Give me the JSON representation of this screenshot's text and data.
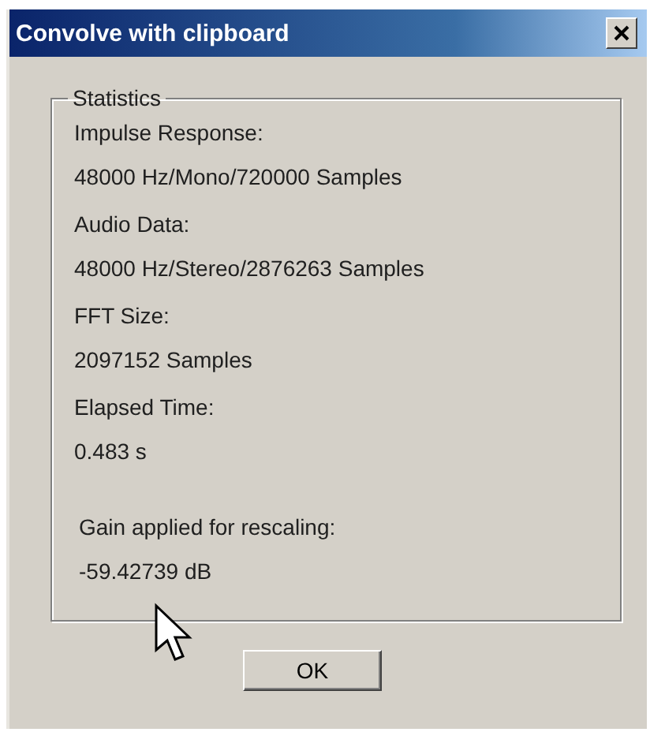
{
  "window": {
    "title": "Convolve with clipboard"
  },
  "statistics": {
    "legend": "Statistics",
    "items": [
      {
        "label": "Impulse Response:",
        "value": "48000 Hz/Mono/720000 Samples"
      },
      {
        "label": "Audio Data:",
        "value": "48000 Hz/Stereo/2876263 Samples"
      },
      {
        "label": "FFT Size:",
        "value": "2097152 Samples"
      },
      {
        "label": "Elapsed Time:",
        "value": "0.483 s"
      },
      {
        "label": "Gain applied for rescaling:",
        "value": "-59.42739 dB"
      }
    ]
  },
  "buttons": [
    "OK"
  ]
}
